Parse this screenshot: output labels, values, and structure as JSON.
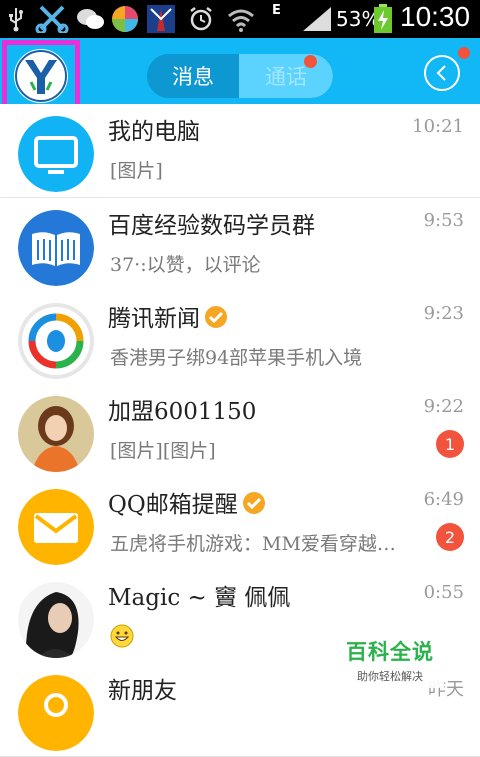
{
  "status_bar": {
    "battery_percent": "53%",
    "network_type": "E",
    "time": "10:30"
  },
  "header": {
    "tabs": [
      {
        "label": "消息",
        "active": true
      },
      {
        "label": "通话",
        "active": false,
        "has_dot": true
      }
    ],
    "back_has_dot": true
  },
  "conversations": [
    {
      "name": "我的电脑",
      "preview": "[图片]",
      "time": "10:21",
      "badge": "",
      "avatar": "computer-icon",
      "verified": false
    },
    {
      "name": "百度经验数码学员群",
      "preview": "37·:以赞，以评论",
      "time": "9:53",
      "badge": "",
      "avatar": "book-icon",
      "verified": false
    },
    {
      "name": "腾讯新闻",
      "preview": "香港男子绑94部苹果手机入境",
      "time": "9:23",
      "badge": "",
      "avatar": "tencent-news-icon",
      "verified": true
    },
    {
      "name": "加盟6001150",
      "preview": "[图片][图片]",
      "time": "9:22",
      "badge": "1",
      "avatar": "user-photo",
      "verified": false
    },
    {
      "name": "QQ邮箱提醒",
      "preview": "五虎将手机游戏：MM爱看穿越…",
      "time": "6:49",
      "badge": "2",
      "avatar": "mail-icon",
      "verified": true
    },
    {
      "name": " Magic ~ 竇 佩佩",
      "preview": "",
      "time": "0:55",
      "badge": "",
      "avatar": "user-photo",
      "verified": false,
      "emoji": "grin-emoji"
    },
    {
      "name": "新朋友",
      "preview": "",
      "time": "昨天",
      "badge": "",
      "avatar": "new-friend-icon",
      "verified": false
    }
  ],
  "watermark": {
    "title": "百科全说",
    "subtitle": "助你轻松解决"
  },
  "colors": {
    "header": "#12b7f5",
    "badge": "#f2533c",
    "highlight_border": "#e82fd8"
  }
}
